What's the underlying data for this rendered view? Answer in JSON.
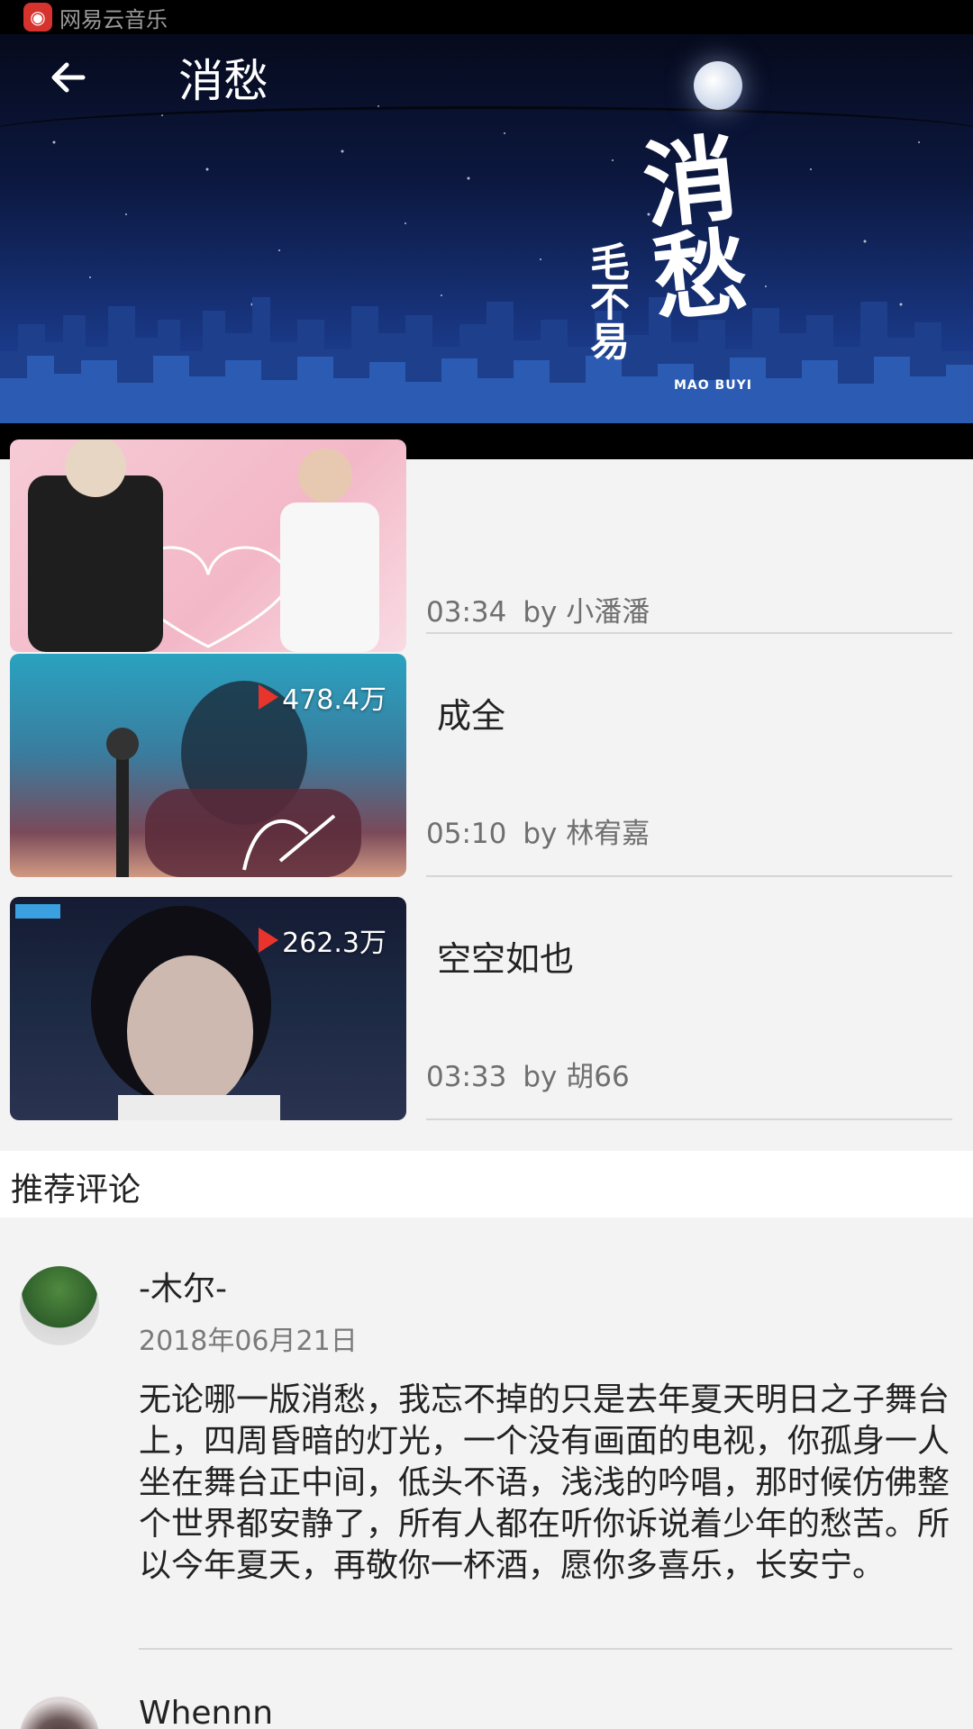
{
  "status_bar": {
    "app_name": "网易云音乐"
  },
  "header": {
    "title": "消愁",
    "banner_title": "消愁",
    "banner_artist": "毛不易",
    "banner_latin": "MAO BUYI"
  },
  "videos": [
    {
      "title": "",
      "play_count": "",
      "duration": "03:34",
      "by": "by 小潘潘"
    },
    {
      "title": "成全",
      "play_count": "478.4万",
      "duration": "05:10",
      "by": "by 林宥嘉"
    },
    {
      "title": "空空如也",
      "play_count": "262.3万",
      "duration": "03:33",
      "by": "by 胡66"
    }
  ],
  "comments_section": {
    "title": "推荐评论",
    "comments": [
      {
        "user": "-木尔-",
        "date": "2018年06月21日",
        "text": "无论哪一版消愁，我忘不掉的只是去年夏天明日之子舞台上，四周昏暗的灯光，一个没有画面的电视，你孤身一人坐在舞台正中间，低头不语，浅浅的吟唱，那时候仿佛整个世界都安静了，所有人都在听你诉说着少年的愁苦。所以今年夏天，再敬你一杯酒，愿你多喜乐，长安宁。"
      },
      {
        "user": "Whennn_"
      }
    ]
  }
}
